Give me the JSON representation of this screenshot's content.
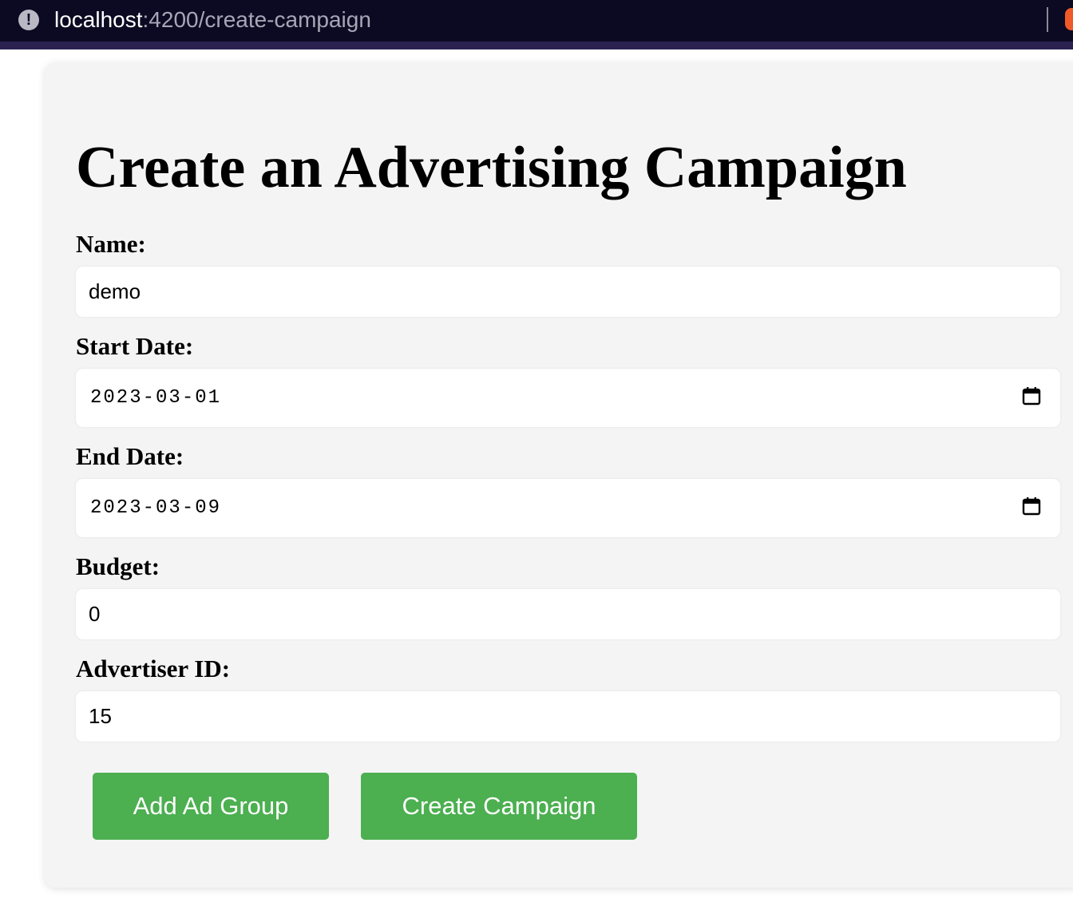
{
  "browser": {
    "url_host": "localhost",
    "url_path": ":4200/create-campaign"
  },
  "page": {
    "title": "Create an Advertising Campaign"
  },
  "form": {
    "name": {
      "label": "Name:",
      "value": "demo"
    },
    "start_date": {
      "label": "Start Date:",
      "value": "2023-03-01"
    },
    "end_date": {
      "label": "End Date:",
      "value": "2023-03-09"
    },
    "budget": {
      "label": "Budget:",
      "value": "0"
    },
    "advertiser_id": {
      "label": "Advertiser ID:",
      "value": "15"
    }
  },
  "buttons": {
    "add_ad_group": "Add Ad Group",
    "create_campaign": "Create Campaign"
  },
  "colors": {
    "button_green": "#4caf50",
    "card_background": "#f4f4f4",
    "browser_bar": "#0c0a22"
  }
}
